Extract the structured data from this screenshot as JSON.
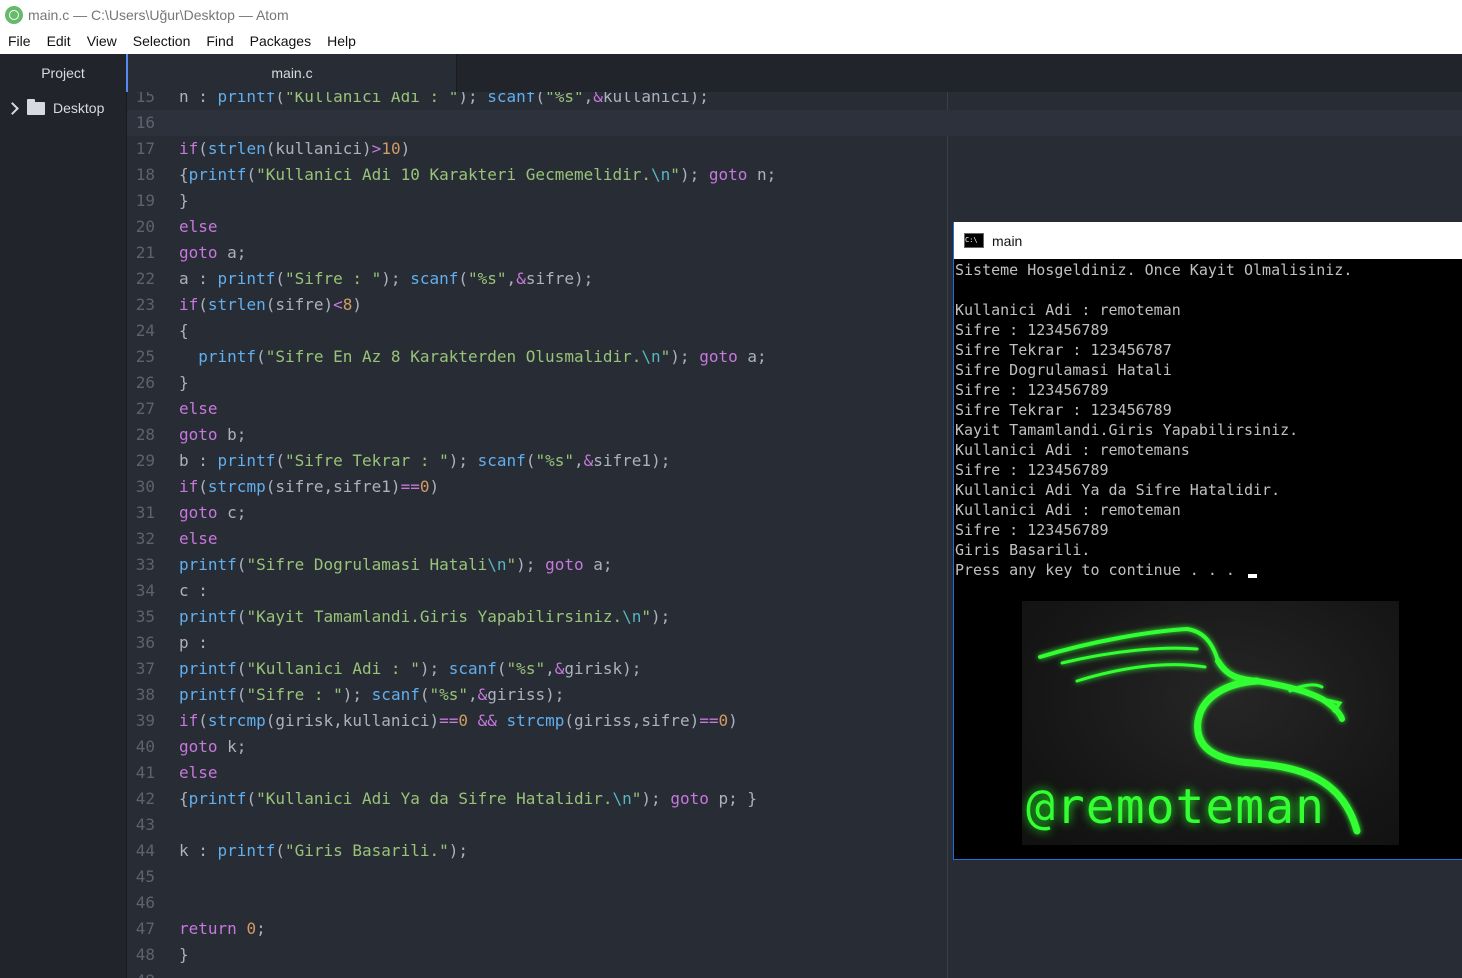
{
  "window": {
    "title": "main.c — C:\\Users\\Uğur\\Desktop — Atom"
  },
  "menu": [
    "File",
    "Edit",
    "View",
    "Selection",
    "Find",
    "Packages",
    "Help"
  ],
  "tabs": {
    "project": "Project",
    "file": "main.c"
  },
  "tree": {
    "folder": "Desktop"
  },
  "editor": {
    "lines": [
      {
        "no": "15",
        "tokens": [
          [
            "p",
            "n : "
          ],
          [
            "f",
            "printf"
          ],
          [
            "p",
            "("
          ],
          [
            "s",
            "\"Kullanici Adi : \""
          ],
          [
            "p",
            "); "
          ],
          [
            "f",
            "scanf"
          ],
          [
            "p",
            "("
          ],
          [
            "s",
            "\"%s\""
          ],
          [
            "p",
            ","
          ],
          [
            "k",
            "&"
          ],
          [
            "p",
            "kullanici);"
          ]
        ]
      },
      {
        "no": "16",
        "cursor": true,
        "tokens": []
      },
      {
        "no": "17",
        "tokens": [
          [
            "k",
            "if"
          ],
          [
            "p",
            "("
          ],
          [
            "f",
            "strlen"
          ],
          [
            "p",
            "(kullanici)"
          ],
          [
            "k",
            ">"
          ],
          [
            "n",
            "10"
          ],
          [
            "p",
            ")"
          ]
        ]
      },
      {
        "no": "18",
        "tokens": [
          [
            "p",
            "{"
          ],
          [
            "f",
            "printf"
          ],
          [
            "p",
            "("
          ],
          [
            "s",
            "\"Kullanici Adi 10 Karakteri Gecmemelidir."
          ],
          [
            "e",
            "\\n"
          ],
          [
            "s",
            "\""
          ],
          [
            "p",
            "); "
          ],
          [
            "k",
            "goto"
          ],
          [
            "p",
            " n;"
          ]
        ]
      },
      {
        "no": "19",
        "tokens": [
          [
            "p",
            "}"
          ]
        ]
      },
      {
        "no": "20",
        "tokens": [
          [
            "k",
            "else"
          ]
        ]
      },
      {
        "no": "21",
        "tokens": [
          [
            "k",
            "goto"
          ],
          [
            "p",
            " a;"
          ]
        ]
      },
      {
        "no": "22",
        "tokens": [
          [
            "p",
            "a : "
          ],
          [
            "f",
            "printf"
          ],
          [
            "p",
            "("
          ],
          [
            "s",
            "\"Sifre : \""
          ],
          [
            "p",
            "); "
          ],
          [
            "f",
            "scanf"
          ],
          [
            "p",
            "("
          ],
          [
            "s",
            "\"%s\""
          ],
          [
            "p",
            ","
          ],
          [
            "k",
            "&"
          ],
          [
            "p",
            "sifre);"
          ]
        ]
      },
      {
        "no": "23",
        "tokens": [
          [
            "k",
            "if"
          ],
          [
            "p",
            "("
          ],
          [
            "f",
            "strlen"
          ],
          [
            "p",
            "(sifre)"
          ],
          [
            "k",
            "<"
          ],
          [
            "n",
            "8"
          ],
          [
            "p",
            ")"
          ]
        ]
      },
      {
        "no": "24",
        "tokens": [
          [
            "p",
            "{"
          ]
        ]
      },
      {
        "no": "25",
        "tokens": [
          [
            "p",
            "  "
          ],
          [
            "f",
            "printf"
          ],
          [
            "p",
            "("
          ],
          [
            "s",
            "\"Sifre En Az 8 Karakterden Olusmalidir."
          ],
          [
            "e",
            "\\n"
          ],
          [
            "s",
            "\""
          ],
          [
            "p",
            "); "
          ],
          [
            "k",
            "goto"
          ],
          [
            "p",
            " a;"
          ]
        ]
      },
      {
        "no": "26",
        "tokens": [
          [
            "p",
            "}"
          ]
        ]
      },
      {
        "no": "27",
        "tokens": [
          [
            "k",
            "else"
          ]
        ]
      },
      {
        "no": "28",
        "tokens": [
          [
            "k",
            "goto"
          ],
          [
            "p",
            " b;"
          ]
        ]
      },
      {
        "no": "29",
        "tokens": [
          [
            "p",
            "b : "
          ],
          [
            "f",
            "printf"
          ],
          [
            "p",
            "("
          ],
          [
            "s",
            "\"Sifre Tekrar : \""
          ],
          [
            "p",
            "); "
          ],
          [
            "f",
            "scanf"
          ],
          [
            "p",
            "("
          ],
          [
            "s",
            "\"%s\""
          ],
          [
            "p",
            ","
          ],
          [
            "k",
            "&"
          ],
          [
            "p",
            "sifre1);"
          ]
        ]
      },
      {
        "no": "30",
        "tokens": [
          [
            "k",
            "if"
          ],
          [
            "p",
            "("
          ],
          [
            "f",
            "strcmp"
          ],
          [
            "p",
            "(sifre,sifre1)"
          ],
          [
            "k",
            "=="
          ],
          [
            "n",
            "0"
          ],
          [
            "p",
            ")"
          ]
        ]
      },
      {
        "no": "31",
        "tokens": [
          [
            "k",
            "goto"
          ],
          [
            "p",
            " c;"
          ]
        ]
      },
      {
        "no": "32",
        "tokens": [
          [
            "k",
            "else"
          ]
        ]
      },
      {
        "no": "33",
        "tokens": [
          [
            "f",
            "printf"
          ],
          [
            "p",
            "("
          ],
          [
            "s",
            "\"Sifre Dogrulamasi Hatali"
          ],
          [
            "e",
            "\\n"
          ],
          [
            "s",
            "\""
          ],
          [
            "p",
            "); "
          ],
          [
            "k",
            "goto"
          ],
          [
            "p",
            " a;"
          ]
        ]
      },
      {
        "no": "34",
        "tokens": [
          [
            "p",
            "c :"
          ]
        ]
      },
      {
        "no": "35",
        "tokens": [
          [
            "f",
            "printf"
          ],
          [
            "p",
            "("
          ],
          [
            "s",
            "\"Kayit Tamamlandi.Giris Yapabilirsiniz."
          ],
          [
            "e",
            "\\n"
          ],
          [
            "s",
            "\""
          ],
          [
            "p",
            ");"
          ]
        ]
      },
      {
        "no": "36",
        "tokens": [
          [
            "p",
            "p :"
          ]
        ]
      },
      {
        "no": "37",
        "tokens": [
          [
            "f",
            "printf"
          ],
          [
            "p",
            "("
          ],
          [
            "s",
            "\"Kullanici Adi : \""
          ],
          [
            "p",
            "); "
          ],
          [
            "f",
            "scanf"
          ],
          [
            "p",
            "("
          ],
          [
            "s",
            "\"%s\""
          ],
          [
            "p",
            ","
          ],
          [
            "k",
            "&"
          ],
          [
            "p",
            "girisk);"
          ]
        ]
      },
      {
        "no": "38",
        "tokens": [
          [
            "f",
            "printf"
          ],
          [
            "p",
            "("
          ],
          [
            "s",
            "\"Sifre : \""
          ],
          [
            "p",
            "); "
          ],
          [
            "f",
            "scanf"
          ],
          [
            "p",
            "("
          ],
          [
            "s",
            "\"%s\""
          ],
          [
            "p",
            ","
          ],
          [
            "k",
            "&"
          ],
          [
            "p",
            "giriss);"
          ]
        ]
      },
      {
        "no": "39",
        "tokens": [
          [
            "k",
            "if"
          ],
          [
            "p",
            "("
          ],
          [
            "f",
            "strcmp"
          ],
          [
            "p",
            "(girisk,kullanici)"
          ],
          [
            "k",
            "=="
          ],
          [
            "n",
            "0"
          ],
          [
            "p",
            " "
          ],
          [
            "k",
            "&&"
          ],
          [
            "p",
            " "
          ],
          [
            "f",
            "strcmp"
          ],
          [
            "p",
            "(giriss,sifre)"
          ],
          [
            "k",
            "=="
          ],
          [
            "n",
            "0"
          ],
          [
            "p",
            ")"
          ]
        ]
      },
      {
        "no": "40",
        "tokens": [
          [
            "k",
            "goto"
          ],
          [
            "p",
            " k;"
          ]
        ]
      },
      {
        "no": "41",
        "tokens": [
          [
            "k",
            "else"
          ]
        ]
      },
      {
        "no": "42",
        "tokens": [
          [
            "p",
            "{"
          ],
          [
            "f",
            "printf"
          ],
          [
            "p",
            "("
          ],
          [
            "s",
            "\"Kullanici Adi Ya da Sifre Hatalidir."
          ],
          [
            "e",
            "\\n"
          ],
          [
            "s",
            "\""
          ],
          [
            "p",
            "); "
          ],
          [
            "k",
            "goto"
          ],
          [
            "p",
            " p; }"
          ]
        ]
      },
      {
        "no": "43",
        "tokens": []
      },
      {
        "no": "44",
        "tokens": [
          [
            "p",
            "k : "
          ],
          [
            "f",
            "printf"
          ],
          [
            "p",
            "("
          ],
          [
            "s",
            "\"Giris Basarili.\""
          ],
          [
            "p",
            ");"
          ]
        ]
      },
      {
        "no": "45",
        "tokens": []
      },
      {
        "no": "46",
        "tokens": []
      },
      {
        "no": "47",
        "tokens": [
          [
            "k",
            "return"
          ],
          [
            "p",
            " "
          ],
          [
            "n",
            "0"
          ],
          [
            "p",
            ";"
          ]
        ]
      },
      {
        "no": "48",
        "tokens": [
          [
            "p",
            "}"
          ]
        ]
      },
      {
        "no": "49",
        "tokens": []
      }
    ]
  },
  "console": {
    "title": "main",
    "lines": [
      "Sisteme Hosgeldiniz. Once Kayit Olmalisiniz.",
      "",
      "Kullanici Adi : remoteman",
      "Sifre : 123456789",
      "Sifre Tekrar : 123456787",
      "Sifre Dogrulamasi Hatali",
      "Sifre : 123456789",
      "Sifre Tekrar : 123456789",
      "Kayit Tamamlandi.Giris Yapabilirsiniz.",
      "Kullanici Adi : remotemans",
      "Sifre : 123456789",
      "Kullanici Adi Ya da Sifre Hatalidir.",
      "Kullanici Adi : remoteman",
      "Sifre : 123456789",
      "Giris Basarili.",
      "Press any key to continue . . . "
    ],
    "logo_text": "@remoteman"
  },
  "colors": {
    "keyword": "#c678dd",
    "function": "#61afef",
    "string": "#98c379",
    "number": "#d19a66",
    "escape": "#56b6c2",
    "logo_green": "#33ff33"
  }
}
